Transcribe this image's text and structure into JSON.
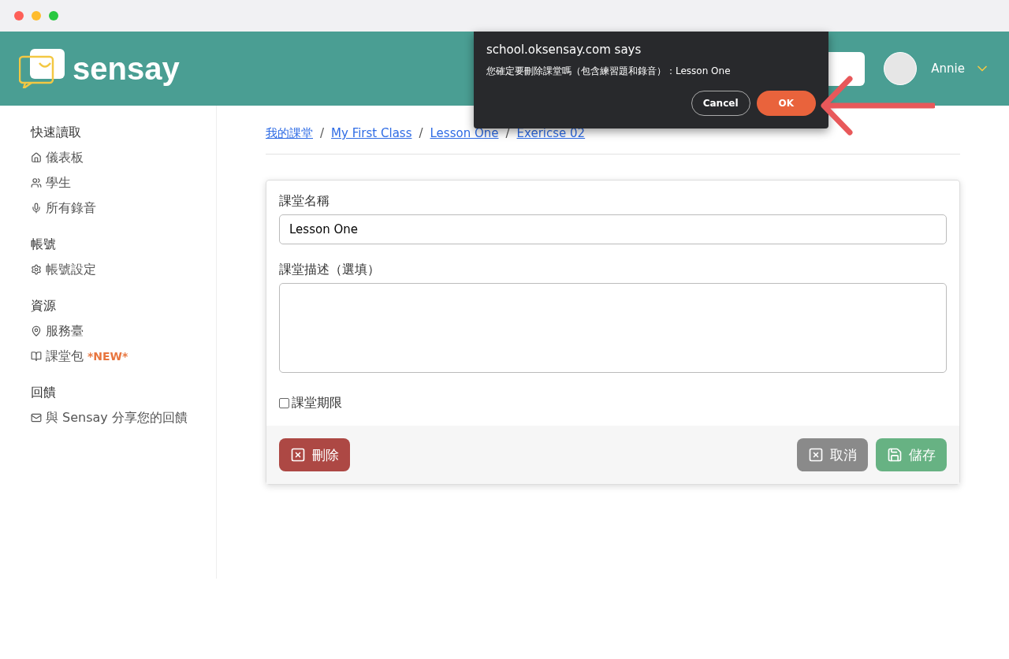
{
  "header": {
    "logo": "sensay",
    "user": {
      "name": "Annie"
    }
  },
  "dialog": {
    "title": "school.oksensay.com says",
    "message": "您確定要刪除課堂嗎（包含練習題和錄音）：Lesson One",
    "buttons": [
      {
        "label": "Cancel",
        "kind": "secondary"
      },
      {
        "label": "OK",
        "kind": "primary"
      }
    ]
  },
  "sidebar": {
    "sections": [
      {
        "title": "快速讀取",
        "items": [
          {
            "label": "儀表板"
          },
          {
            "label": "學生"
          },
          {
            "label": "所有錄音"
          }
        ]
      },
      {
        "title": "帳號",
        "items": [
          {
            "label": "帳號設定"
          }
        ]
      },
      {
        "title": "資源",
        "items": [
          {
            "label": "服務臺"
          },
          {
            "label": "課堂包",
            "badge": "*NEW*"
          }
        ]
      },
      {
        "title": "回饋",
        "items": [
          {
            "label": "與 Sensay 分享您的回饋"
          }
        ]
      }
    ]
  },
  "breadcrumb": {
    "separator": "/",
    "links": [
      "我的課堂",
      "My First Class",
      "Lesson One",
      "Exericse 02"
    ]
  },
  "form": {
    "name_label": "課堂名稱",
    "name_value": "Lesson One",
    "description_label": "課堂描述（選填）",
    "deadline": {
      "label": "課堂期限",
      "checked": false
    },
    "buttons": [
      {
        "label": "刪除",
        "kind": "delete"
      },
      {
        "label": "取消",
        "kind": "cancel"
      },
      {
        "label": "儲存",
        "kind": "save"
      }
    ]
  }
}
